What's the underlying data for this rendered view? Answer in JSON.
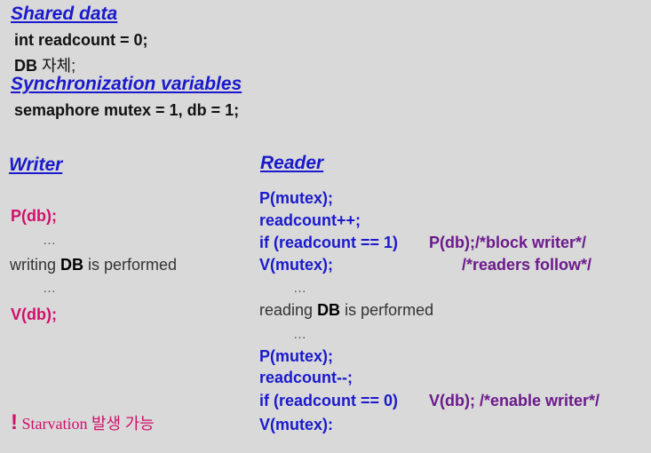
{
  "shared": {
    "heading": "Shared data",
    "line1": "int readcount = 0;",
    "line2_bold": "DB",
    "line2_rest": " 자체;"
  },
  "sync": {
    "heading": "Synchronization variables",
    "line": "semaphore mutex = 1, db = 1;"
  },
  "writer": {
    "heading": "Writer",
    "p_db": "P(db);",
    "dots": "…",
    "writing_pre": "writing ",
    "writing_bold": "DB",
    "writing_post": " is performed",
    "v_db": "V(db);"
  },
  "reader": {
    "heading": "Reader",
    "l1": "P(mutex);",
    "l2": "readcount++;",
    "l3_cond": "if (readcount == 1)",
    "l3_call": "P(db);/*block writer*/",
    "l4": "V(mutex);",
    "l4_comment": "/*readers follow*/",
    "dots": "…",
    "reading_pre": "reading ",
    "reading_bold": "DB",
    "reading_post": " is performed",
    "l6": "P(mutex);",
    "l7": "readcount--;",
    "l8_cond": "if (readcount == 0)",
    "l8_call": "V(db); /*enable writer*/",
    "l9": "V(mutex):"
  },
  "note": {
    "bang": "!",
    "text": " Starvation 발생 가능"
  }
}
